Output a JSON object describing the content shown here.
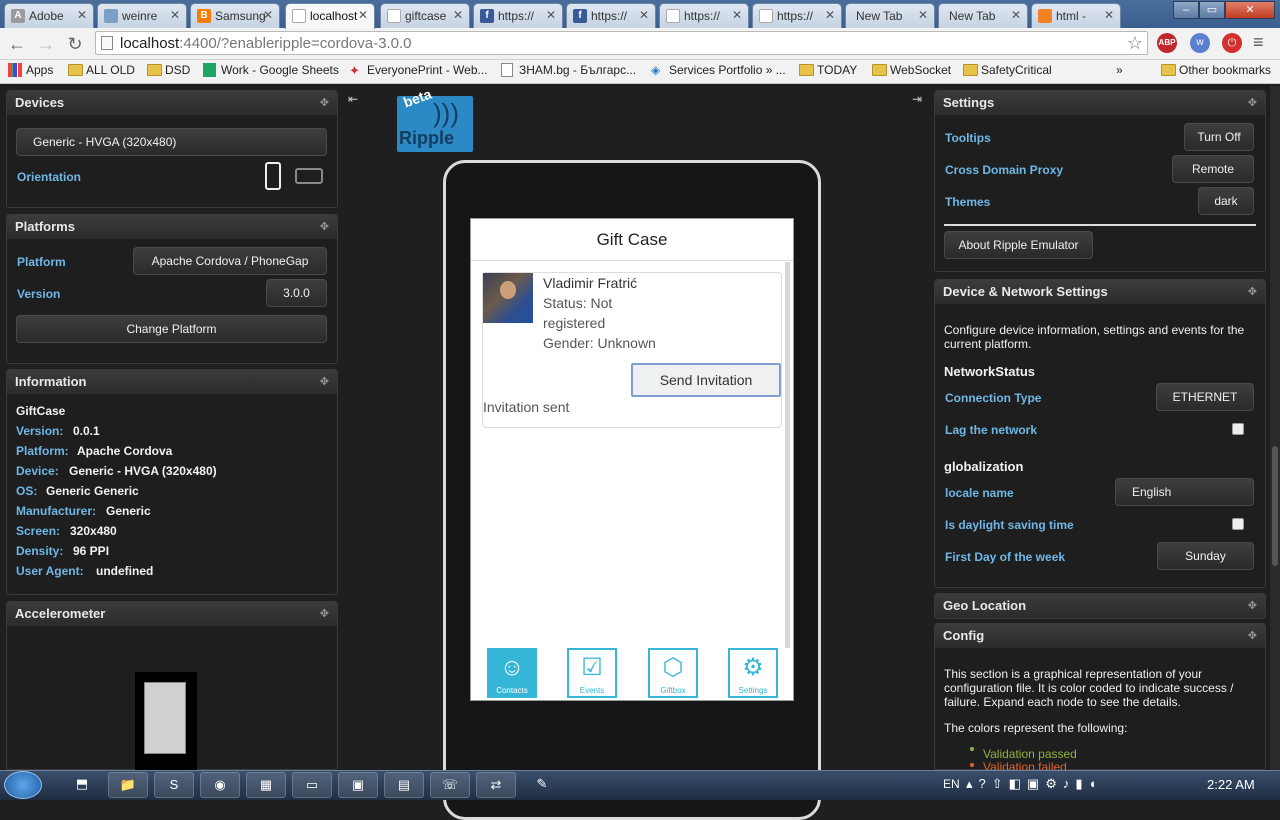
{
  "browser": {
    "tabs": [
      {
        "label": "Adobe",
        "icon": "adobe-icon"
      },
      {
        "label": "weinre",
        "icon": "page-icon"
      },
      {
        "label": "Samsung",
        "icon": "blogger-icon"
      },
      {
        "label": "localhost",
        "icon": "page-icon"
      },
      {
        "label": "giftcase",
        "icon": "page-icon"
      },
      {
        "label": "https://",
        "icon": "facebook-icon"
      },
      {
        "label": "https://",
        "icon": "facebook-icon"
      },
      {
        "label": "https://",
        "icon": "page-icon"
      },
      {
        "label": "https://",
        "icon": "page-icon"
      },
      {
        "label": "New Tab",
        "icon": "none"
      },
      {
        "label": "New Tab",
        "icon": "none"
      },
      {
        "label": "html -",
        "icon": "stackoverflow-icon"
      }
    ],
    "url_host": "localhost",
    "url_rest": ":4400/?enableripple=cordova-3.0.0",
    "bookmarks": [
      "Apps",
      "ALL OLD",
      "DSD",
      "Work - Google Sheets",
      "EveryonePrint - Web...",
      "ЗНАМ.bg - Българс...",
      "Services Portfolio » ...",
      "TODAY",
      "WebSocket",
      "SafetyCritical",
      "»",
      "Other bookmarks"
    ]
  },
  "left": {
    "devices": {
      "title": "Devices",
      "device": "Generic - HVGA (320x480)",
      "orientation_label": "Orientation"
    },
    "platforms": {
      "title": "Platforms",
      "platform_label": "Platform",
      "platform_value": "Apache Cordova / PhoneGap",
      "version_label": "Version",
      "version_value": "3.0.0",
      "change_button": "Change Platform"
    },
    "information": {
      "title": "Information",
      "app_name": "GiftCase",
      "rows": [
        {
          "k": "Version:",
          "v": "0.0.1"
        },
        {
          "k": "Platform:",
          "v": "Apache Cordova"
        },
        {
          "k": "Device:",
          "v": "Generic - HVGA (320x480)"
        },
        {
          "k": "OS:",
          "v": "Generic Generic"
        },
        {
          "k": "Manufacturer:",
          "v": "Generic"
        },
        {
          "k": "Screen:",
          "v": "320x480"
        },
        {
          "k": "Density:",
          "v": "96 PPI"
        },
        {
          "k": "User Agent:",
          "v": "undefined"
        }
      ]
    },
    "accelerometer": {
      "title": "Accelerometer"
    }
  },
  "center": {
    "logo_beta": "beta",
    "logo_text": "Ripple",
    "app": {
      "title": "Gift Case",
      "contact_name": "Vladimir Fratrić",
      "status_line1": "Status: Not",
      "status_line2": "registered",
      "gender": "Gender: Unknown",
      "send_button": "Send Invitation",
      "invitation_status": "Invitation sent",
      "tabs": [
        {
          "label": "Contacts",
          "icon": "contacts-icon"
        },
        {
          "label": "Events",
          "icon": "events-icon"
        },
        {
          "label": "Giftbox",
          "icon": "giftbox-icon"
        },
        {
          "label": "Settings",
          "icon": "settings-icon"
        }
      ]
    }
  },
  "right": {
    "settings": {
      "title": "Settings",
      "tooltips_label": "Tooltips",
      "tooltips_button": "Turn Off",
      "proxy_label": "Cross Domain Proxy",
      "proxy_button": "Remote",
      "themes_label": "Themes",
      "themes_button": "dark",
      "about_button": "About Ripple Emulator"
    },
    "device_network": {
      "title": "Device & Network Settings",
      "description": "Configure device information, settings and events for the current platform.",
      "network_heading": "NetworkStatus",
      "connection_label": "Connection Type",
      "connection_value": "ETHERNET",
      "lag_label": "Lag the network",
      "glob_heading": "globalization",
      "locale_label": "locale name",
      "locale_value": "English",
      "dst_label": "Is daylight saving time",
      "firstday_label": "First Day of the week",
      "firstday_value": "Sunday"
    },
    "geo": {
      "title": "Geo Location"
    },
    "config": {
      "title": "Config",
      "description": "This section is a graphical representation of your configuration file. It is color coded to indicate success / failure. Expand each node to see the details.",
      "colors_intro": "The colors represent the following:",
      "legend_passed": "Validation passed",
      "legend_failed": "Validation failed",
      "passed_color": "#8db33c",
      "failed_color": "#e0632a"
    }
  },
  "taskbar": {
    "lang": "EN",
    "time": "2:22 AM"
  }
}
